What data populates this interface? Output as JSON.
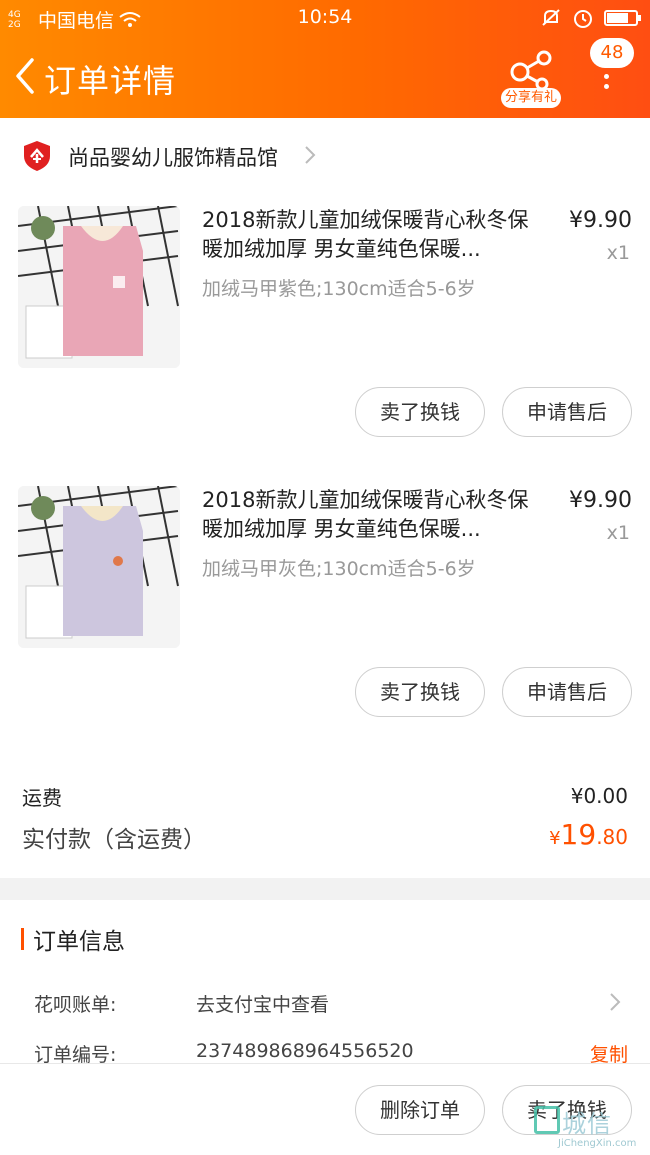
{
  "statusbar": {
    "carrier": "中国电信",
    "signal_text": "4G 2G",
    "time": "10:54"
  },
  "header": {
    "title": "订单详情",
    "share_label": "分享有礼",
    "message_count": "48"
  },
  "shop": {
    "name": "尚品婴幼儿服饰精品馆",
    "icon": "shop-badge-icon"
  },
  "items": [
    {
      "title": "2018新款儿童加绒保暖背心秋冬保暖加绒加厚 男女童纯色保暖...",
      "sku": "加绒马甲紫色;130cm适合5-6岁",
      "price": "¥9.90",
      "qty": "x1",
      "sell_label": "卖了换钱",
      "after_sale_label": "申请售后",
      "vest_color": "#e9a6b6"
    },
    {
      "title": "2018新款儿童加绒保暖背心秋冬保暖加绒加厚 男女童纯色保暖...",
      "sku": "加绒马甲灰色;130cm适合5-6岁",
      "price": "¥9.90",
      "qty": "x1",
      "sell_label": "卖了换钱",
      "after_sale_label": "申请售后",
      "vest_color": "#cdc6de"
    }
  ],
  "totals": {
    "shipping_label": "运费",
    "shipping_value": "¥0.00",
    "paid_label": "实付款（含运费）",
    "paid_currency": "¥",
    "paid_int": "19",
    "paid_dec": ".80"
  },
  "order_info": {
    "heading": "订单信息",
    "huabei_label": "花呗账单:",
    "huabei_value": "去支付宝中查看",
    "order_no_label": "订单编号:",
    "order_no_value": "237489868964556520",
    "copy_label": "复制"
  },
  "bottom": {
    "delete_label": "删除订单",
    "sell_label": "卖了换钱"
  },
  "watermark": {
    "main": "城信",
    "sub": "JiChengXin.com"
  },
  "colors": {
    "accent": "#ff5000",
    "header_start": "#ff8a00",
    "header_end": "#ff4e12"
  }
}
